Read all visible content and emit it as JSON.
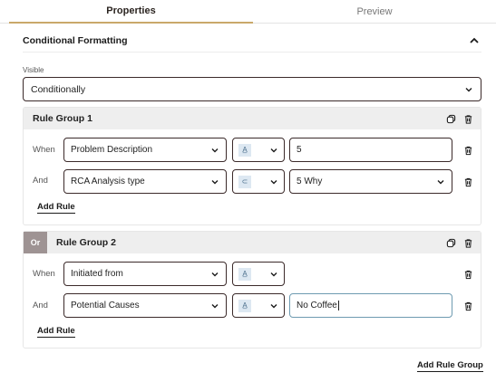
{
  "tabs": [
    {
      "label": "Properties",
      "active": true
    },
    {
      "label": "Preview",
      "active": false
    }
  ],
  "section": {
    "title": "Conditional Formatting"
  },
  "visible": {
    "label": "Visible",
    "value": "Conditionally"
  },
  "groups": [
    {
      "title": "Rule Group 1",
      "rules": [
        {
          "connector": "When",
          "field": "Problem Description",
          "operator_icon": "text-a-underline-icon",
          "value": "5"
        },
        {
          "connector": "And",
          "field": "RCA Analysis type",
          "operator_icon": "contains-icon",
          "value": "5 Why"
        }
      ],
      "add_rule": "Add Rule"
    },
    {
      "or_label": "Or",
      "title": "Rule Group 2",
      "rules": [
        {
          "connector": "When",
          "field": "Initiated from",
          "operator_icon": "text-a-underline-icon"
        },
        {
          "connector": "And",
          "field": "Potential Causes",
          "operator_icon": "text-a-underline-icon",
          "value": "No Coffee"
        }
      ],
      "add_rule": "Add Rule"
    }
  ],
  "add_group": "Add Rule Group",
  "colors": {
    "accent": "#c9a86a",
    "border": "#3b2a2a",
    "focus": "#6e9bb1",
    "group_header": "#eeeeee",
    "or_badge": "#9e9393"
  }
}
